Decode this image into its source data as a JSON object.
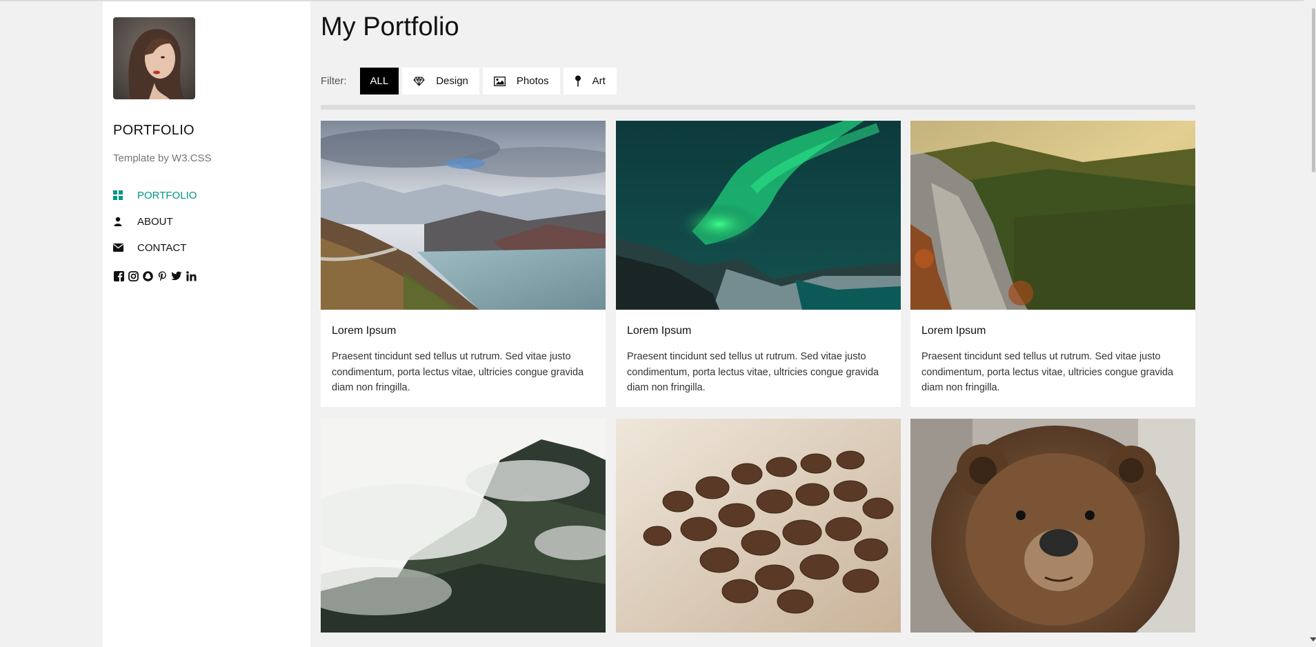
{
  "sidebar": {
    "brand": "PORTFOLIO",
    "subtitle": "Template by W3.CSS",
    "nav": [
      {
        "label": "PORTFOLIO",
        "icon": "th-large-icon",
        "active": true
      },
      {
        "label": "ABOUT",
        "icon": "user-icon",
        "active": false
      },
      {
        "label": "CONTACT",
        "icon": "envelope-icon",
        "active": false
      }
    ],
    "social": [
      "facebook-icon",
      "instagram-icon",
      "snapchat-icon",
      "pinterest-icon",
      "twitter-icon",
      "linkedin-icon"
    ]
  },
  "main": {
    "title": "My Portfolio",
    "filter": {
      "label": "Filter:",
      "buttons": [
        {
          "label": "ALL",
          "icon": null,
          "active": true
        },
        {
          "label": "Design",
          "icon": "diamond-icon",
          "active": false
        },
        {
          "label": "Photos",
          "icon": "photo-icon",
          "active": false
        },
        {
          "label": "Art",
          "icon": "map-pin-icon",
          "active": false
        }
      ]
    },
    "cards": [
      {
        "image": "mountain-lake-image",
        "title": "Lorem Ipsum",
        "text": "Praesent tincidunt sed tellus ut rutrum. Sed vitae justo condimentum, porta lectus vitae, ultricies congue gravida diam non fringilla."
      },
      {
        "image": "northern-lights-image",
        "title": "Lorem Ipsum",
        "text": "Praesent tincidunt sed tellus ut rutrum. Sed vitae justo condimentum, porta lectus vitae, ultricies congue gravida diam non fringilla."
      },
      {
        "image": "forest-valley-image",
        "title": "Lorem Ipsum",
        "text": "Praesent tincidunt sed tellus ut rutrum. Sed vitae justo condimentum, porta lectus vitae, ultricies congue gravida diam non fringilla."
      },
      {
        "image": "misty-mountain-image"
      },
      {
        "image": "coffee-beans-image"
      },
      {
        "image": "bear-image"
      }
    ]
  },
  "colors": {
    "accent": "#009688",
    "active_filter_bg": "#000000",
    "page_bg": "#f1f1f1"
  }
}
